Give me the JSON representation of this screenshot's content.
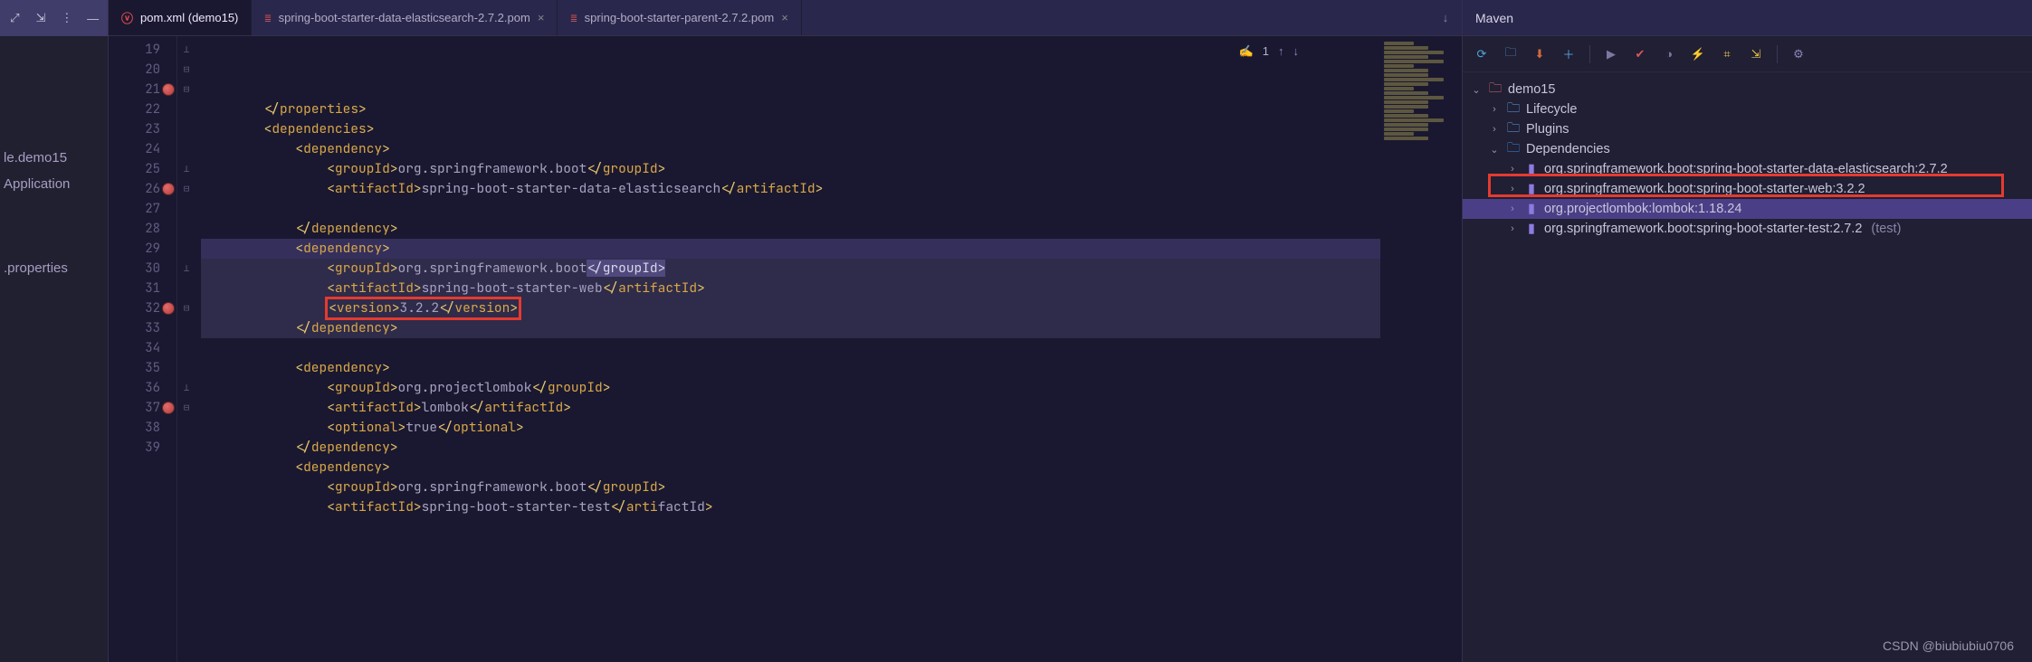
{
  "left": {
    "items": [
      "le.demo15",
      "Application",
      "",
      ".properties"
    ]
  },
  "tabs": [
    {
      "label": "pom.xml (demo15)",
      "icon": "V",
      "active": true
    },
    {
      "label": "spring-boot-starter-data-elasticsearch-2.7.2.pom",
      "icon": "≡",
      "closable": true
    },
    {
      "label": "spring-boot-starter-parent-2.7.2.pom",
      "icon": "≡",
      "closable": true
    }
  ],
  "inlay": {
    "count": "1"
  },
  "gutter": {
    "first": 19,
    "marks": [
      21,
      26,
      32,
      37
    ]
  },
  "code": [
    {
      "n": 19,
      "indent": 2,
      "kind": "close",
      "tag": "properties"
    },
    {
      "n": 20,
      "indent": 2,
      "kind": "open",
      "tag": "dependencies"
    },
    {
      "n": 21,
      "indent": 3,
      "kind": "open",
      "tag": "dependency"
    },
    {
      "n": 22,
      "indent": 4,
      "kind": "elem",
      "tag": "groupId",
      "text": "org.springframework.boot"
    },
    {
      "n": 23,
      "indent": 4,
      "kind": "elem",
      "tag": "artifactId",
      "text": "spring-boot-starter-data-elasticsearch"
    },
    {
      "n": 24,
      "indent": 0,
      "kind": "blank"
    },
    {
      "n": 25,
      "indent": 3,
      "kind": "close",
      "tag": "dependency"
    },
    {
      "n": 26,
      "indent": 3,
      "kind": "open",
      "tag": "dependency",
      "caret": true
    },
    {
      "n": 27,
      "indent": 4,
      "kind": "elemSel",
      "tag": "groupId",
      "text": "org.springframework.boot",
      "hl": true
    },
    {
      "n": 28,
      "indent": 4,
      "kind": "elem",
      "tag": "artifactId",
      "text": "spring-boot-starter-web",
      "hl": true
    },
    {
      "n": 29,
      "indent": 4,
      "kind": "elem",
      "tag": "version",
      "text": "3.2.2",
      "hl": true,
      "redbox": true
    },
    {
      "n": 30,
      "indent": 3,
      "kind": "close",
      "tag": "dependency",
      "hl": true
    },
    {
      "n": 31,
      "indent": 0,
      "kind": "blank"
    },
    {
      "n": 32,
      "indent": 3,
      "kind": "open",
      "tag": "dependency"
    },
    {
      "n": 33,
      "indent": 4,
      "kind": "elem",
      "tag": "groupId",
      "text": "org.projectlombok"
    },
    {
      "n": 34,
      "indent": 4,
      "kind": "elem",
      "tag": "artifactId",
      "text": "lombok"
    },
    {
      "n": 35,
      "indent": 4,
      "kind": "elem",
      "tag": "optional",
      "text": "true"
    },
    {
      "n": 36,
      "indent": 3,
      "kind": "close",
      "tag": "dependency"
    },
    {
      "n": 37,
      "indent": 3,
      "kind": "open",
      "tag": "dependency"
    },
    {
      "n": 38,
      "indent": 4,
      "kind": "elem",
      "tag": "groupId",
      "text": "org.springframework.boot"
    },
    {
      "n": 39,
      "indent": 4,
      "kind": "elemCut",
      "tag": "artifactId",
      "text": "spring-boot-starter-test"
    }
  ],
  "maven": {
    "title": "Maven",
    "project": "demo15",
    "lifecycle": "Lifecycle",
    "plugins": "Plugins",
    "dependencies": "Dependencies",
    "deps": [
      {
        "label": "org.springframework.boot:spring-boot-starter-data-elasticsearch:2.7.2"
      },
      {
        "label": "org.springframework.boot:spring-boot-starter-web:3.2.2",
        "red": true
      },
      {
        "label": "org.projectlombok:lombok:1.18.24",
        "sel": true
      },
      {
        "label": "org.springframework.boot:spring-boot-starter-test:2.7.2",
        "scope": "(test)"
      }
    ]
  },
  "watermark": "CSDN @biubiubiu0706"
}
